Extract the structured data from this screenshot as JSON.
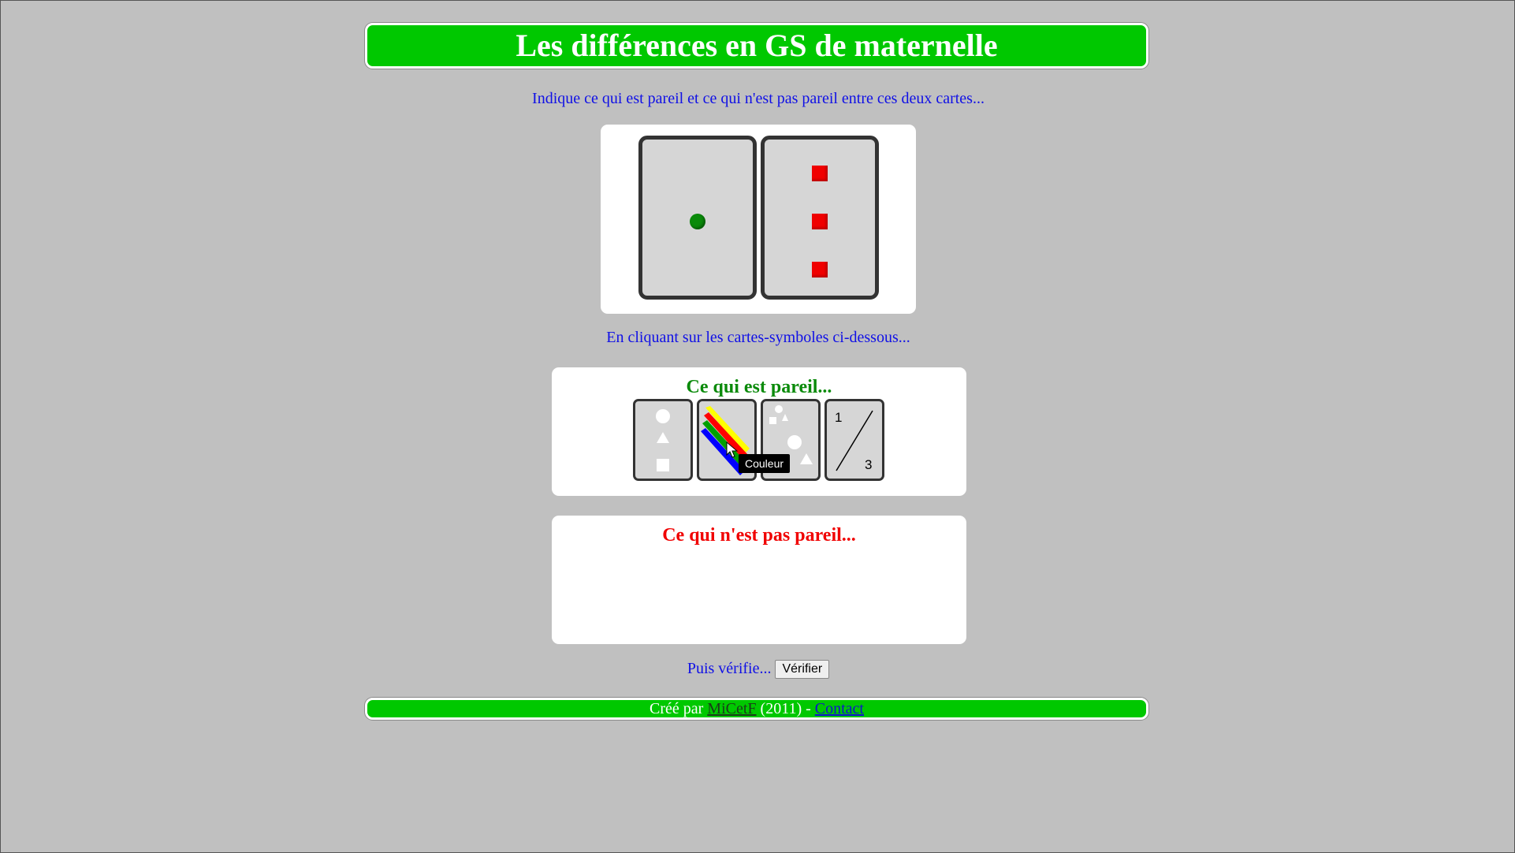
{
  "header": {
    "title": "Les différences en GS de maternelle"
  },
  "instructions": {
    "compare": "Indique ce qui est pareil et ce qui n'est pas pareil entre ces deux cartes...",
    "click": "En cliquant sur les cartes-symboles ci-dessous..."
  },
  "cards": {
    "left": {
      "symbol": "circle",
      "color": "#0a8a0a",
      "count": 1
    },
    "right": {
      "symbol": "square",
      "color": "#f00000",
      "count": 3
    }
  },
  "same_zone": {
    "title": "Ce qui est pareil...",
    "title_color": "#0a8a0a"
  },
  "diff_zone": {
    "title": "Ce qui n'est pas pareil...",
    "title_color": "#f00000"
  },
  "symbol_cards": [
    {
      "name": "shape-card",
      "icon": "shapes-icon"
    },
    {
      "name": "color-card",
      "icon": "color-stripes-icon",
      "tooltip": "Couleur"
    },
    {
      "name": "position-card",
      "icon": "position-icon"
    },
    {
      "name": "number-card",
      "icon": "number-icon",
      "labels": [
        "1",
        "3"
      ]
    }
  ],
  "verify": {
    "prompt": "Puis vérifie...",
    "button_label": "Vérifier"
  },
  "footer": {
    "prefix": "Créé par",
    "author": "MiCetF",
    "middle": "(2011) -",
    "contact": "Contact"
  },
  "colors": {
    "banner": "#00c800",
    "background": "#c0c0c0",
    "instruction_text": "#1010e6"
  }
}
